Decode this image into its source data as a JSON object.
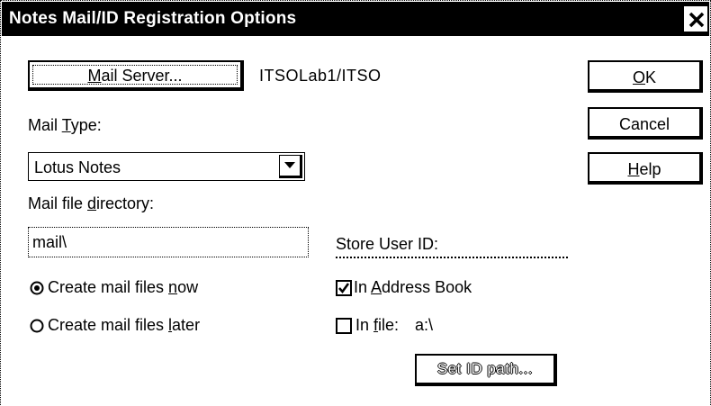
{
  "dialog": {
    "title": "Notes Mail/ID Registration Options",
    "close_icon": "close-icon"
  },
  "mail_server": {
    "button_label": "Mail Server...",
    "value": "ITSOLab1/ITSO"
  },
  "buttons": {
    "ok": "OK",
    "cancel": "Cancel",
    "help": "Help",
    "set_id_path": "Set ID path..."
  },
  "mail_type": {
    "label": "Mail Type:",
    "selected": "Lotus Notes",
    "dropdown_icon": "chevron-down-icon"
  },
  "mail_file_directory": {
    "label": "Mail file directory:",
    "value": "mail\\"
  },
  "create_mail_files": {
    "now_label": "Create mail files now",
    "later_label": "Create mail files later",
    "selected": "now"
  },
  "store_user_id": {
    "label": "Store User ID:",
    "in_address_book_label": "In Address Book",
    "in_address_book_checked": true,
    "in_file_label": "In file:",
    "in_file_checked": false,
    "in_file_path": "a:\\"
  }
}
